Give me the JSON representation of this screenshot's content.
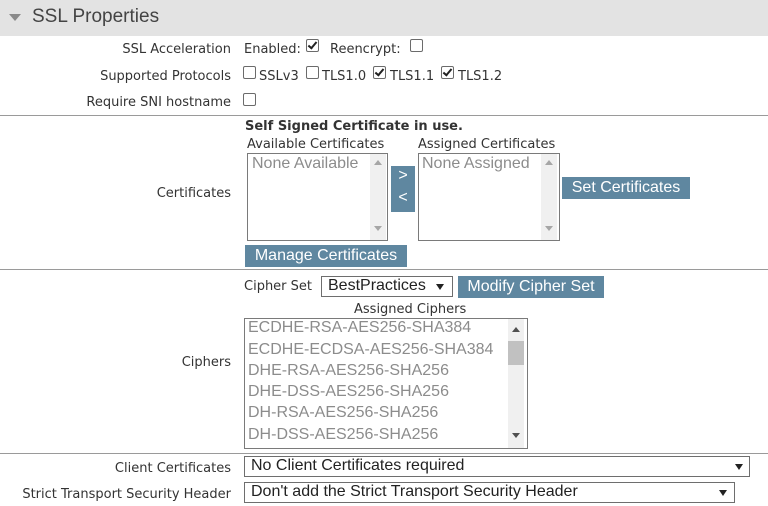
{
  "section": {
    "title": "SSL Properties"
  },
  "ssl_acceleration": {
    "label": "SSL Acceleration",
    "enabled_label": "Enabled:",
    "enabled": true,
    "reencrypt_label": "Reencrypt:",
    "reencrypt": false
  },
  "protocols": {
    "label": "Supported Protocols",
    "items": [
      {
        "label": "SSLv3",
        "checked": false
      },
      {
        "label": "TLS1.0",
        "checked": false
      },
      {
        "label": "TLS1.1",
        "checked": true
      },
      {
        "label": "TLS1.2",
        "checked": true
      }
    ]
  },
  "sni": {
    "label": "Require SNI hostname",
    "checked": false
  },
  "certificates": {
    "label": "Certificates",
    "status": "Self Signed Certificate in use.",
    "available_header": "Available Certificates",
    "available_items": [
      "None Available"
    ],
    "assigned_header": "Assigned Certificates",
    "assigned_items": [
      "None Assigned"
    ],
    "move_right": ">",
    "move_left": "<",
    "set_button": "Set Certificates",
    "manage_button": "Manage Certificates"
  },
  "ciphers": {
    "label": "Ciphers",
    "cipher_set_label": "Cipher Set",
    "cipher_set_value": "BestPractices",
    "modify_button": "Modify Cipher Set",
    "assigned_header": "Assigned Ciphers",
    "items": [
      "ECDHE-RSA-AES256-SHA384",
      "ECDHE-ECDSA-AES256-SHA384",
      "DHE-RSA-AES256-SHA256",
      "DHE-DSS-AES256-SHA256",
      "DH-RSA-AES256-SHA256",
      "DH-DSS-AES256-SHA256"
    ]
  },
  "client_certificates": {
    "label": "Client Certificates",
    "value": "No Client Certificates required"
  },
  "hsts": {
    "label": "Strict Transport Security Header",
    "value": "Don't add the Strict Transport Security Header"
  },
  "colors": {
    "header_bg": "#e3e3e3",
    "button_bg": "#5f87a0",
    "divider": "#9a9a9a"
  }
}
